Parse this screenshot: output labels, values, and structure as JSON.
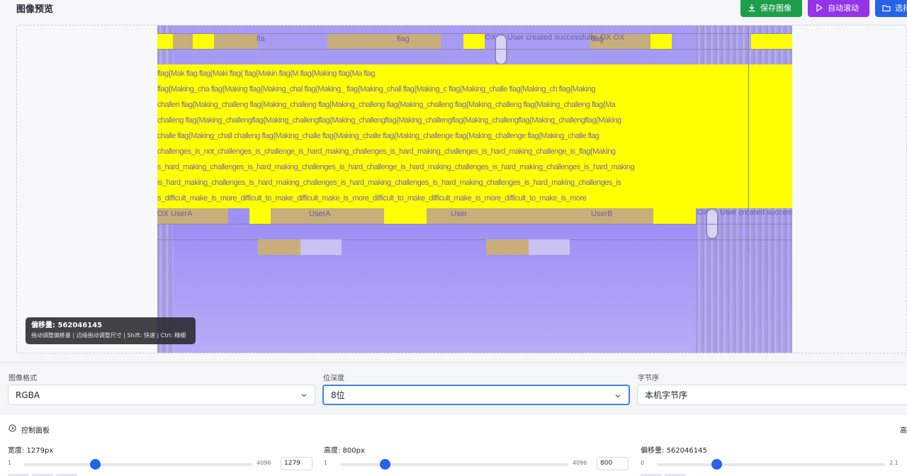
{
  "header": {
    "title": "图像预览",
    "save_label": "保存图像",
    "autoscroll_label": "自动滚动",
    "select_label": "选择"
  },
  "preview": {
    "garbled_rows": [
      "flag{Mak          flag          flag{Maki          flag{          flag{Makin          flag{M          flag{Making          flag{Ma          flag",
      "flag{Making_cha   flag{Making   flag{Making_chal   flag{Making_   flag{Making_chall   flag{Making_c   flag{Making_challe   flag{Making_ch   flag{Making",
      "challen flag{Making_challeng flag{Making_challeng flag{Making_challeng flag{Making_challeng flag{Making_challeng flag{Making_challeng flag{Ma",
      "challeng flag{Making_challengflag{Making_challengflag{Making_challengflag{Making_challengflag{Making_challengflag{Making_challengflag{Making",
      "challe flag{Making_chall challeng flag{Making_challe flag{Making_challe flag{Making_challenge flag{Making_challenge flag{Making_challe flag",
      "challenges_is_not_challenges_is_challenge_is_hard_making_challenges_is_hard_making_challenges_is_hard_making_challenge_is_flag{Making",
      "s_hard_making_challenges_is_hard_making_challenges_is_hard_challenge_is_hard_making_challenges_is_hard_making_challenges_is_hard_making",
      "is_hard_making_challenges_is_hard_making_challenges_is_hard_making_challenges_is_hard_making_challenges_is_hard_making_challenges_is",
      "s_difficult_make_is_more_difficult_to_make_difficult_make_is_more_difficult_to_make_difficult_make_is_more_difficult_to_make_is_more"
    ],
    "top_labels": [
      "fla",
      "flag",
      "OX",
      "User created successfully. OX OX",
      "flag"
    ],
    "bottom_labels": [
      "OX UserA",
      "UserA",
      "User",
      "UserB",
      "OX",
      "User created successfully. OX"
    ],
    "tooltip": {
      "title": "偏移量: 562046145",
      "hint": "拖动调整偏移量 | 边缘拖动调整尺寸 | Shift: 快速 | Ctrl: 精细"
    }
  },
  "format": {
    "image_format_label": "图像格式",
    "image_format_value": "RGBA",
    "bit_depth_label": "位深度",
    "bit_depth_value": "8位",
    "byte_order_label": "字节序",
    "byte_order_value": "本机字节序"
  },
  "panel": {
    "title": "控制面板",
    "right_label": "高",
    "width": {
      "label": "宽度: 1279px",
      "min": "1",
      "max": "4096",
      "value": "1279",
      "fraction": 0.312
    },
    "height": {
      "label": "高度: 800px",
      "min": "1",
      "max": "4096",
      "value": "800",
      "fraction": 0.195
    },
    "offset": {
      "label": "偏移量: 562046145",
      "min": "0",
      "max": "2.1",
      "fraction": 0.262
    }
  },
  "colors": {
    "save_button": "#1e9e4a",
    "autoscroll_button": "#9333ea",
    "select_button": "#2563eb",
    "slider_accent": "#2563eb",
    "highlight_yellow": "#ffff00"
  }
}
